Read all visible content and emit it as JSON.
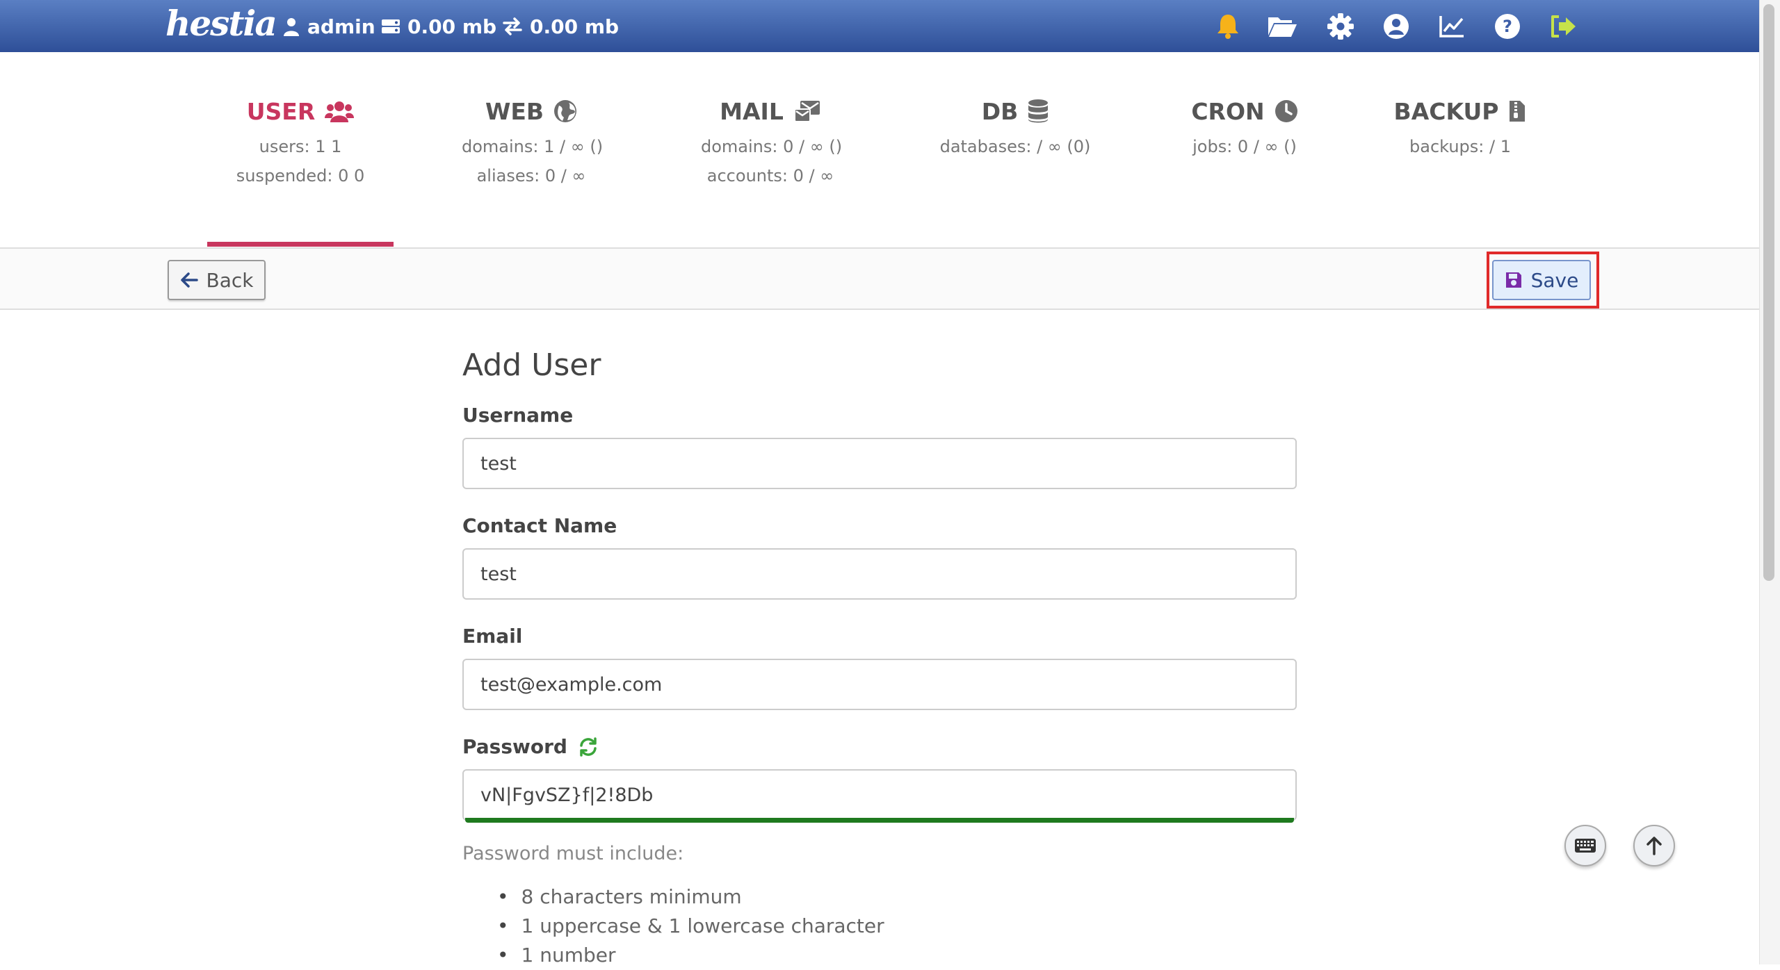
{
  "header": {
    "logo": "hestia",
    "user": "admin",
    "disk": "0.00 mb",
    "bandwidth": "0.00 mb",
    "icons": [
      "bell-icon",
      "folder-icon",
      "gear-icon",
      "user-circle-icon",
      "chart-icon",
      "help-icon",
      "logout-icon"
    ]
  },
  "tabs": [
    {
      "label": "USER",
      "icon": "users-icon",
      "lines": [
        "users: 1 1",
        "suspended: 0 0"
      ],
      "active": true
    },
    {
      "label": "WEB",
      "icon": "globe-icon",
      "lines": [
        "domains: 1 / ∞ ()",
        "aliases: 0 / ∞"
      ]
    },
    {
      "label": "MAIL",
      "icon": "mail-icon",
      "lines": [
        "domains: 0 / ∞ ()",
        "accounts: 0 / ∞"
      ]
    },
    {
      "label": "DB",
      "icon": "database-icon",
      "lines": [
        "databases: / ∞ (0)"
      ]
    },
    {
      "label": "CRON",
      "icon": "clock-icon",
      "lines": [
        "jobs: 0 / ∞ ()"
      ]
    },
    {
      "label": "BACKUP",
      "icon": "file-archive-icon",
      "lines": [
        "backups: / 1"
      ]
    }
  ],
  "toolbar": {
    "back_label": "Back",
    "save_label": "Save"
  },
  "form": {
    "title": "Add User",
    "username_label": "Username",
    "username_value": "test",
    "contact_label": "Contact Name",
    "contact_value": "test",
    "email_label": "Email",
    "email_value": "test@example.com",
    "password_label": "Password",
    "password_value": "vN|FgvSZ}f|2!8Db",
    "password_strength": 1.0,
    "password_help": "Password must include:",
    "password_rules": [
      "8 characters minimum",
      "1 uppercase & 1 lowercase character",
      "1 number"
    ]
  },
  "colors": {
    "accent": "#c8365e",
    "header": "#2e4f98",
    "strength": "#1f7a1f",
    "highlight": "#e02a2a"
  }
}
